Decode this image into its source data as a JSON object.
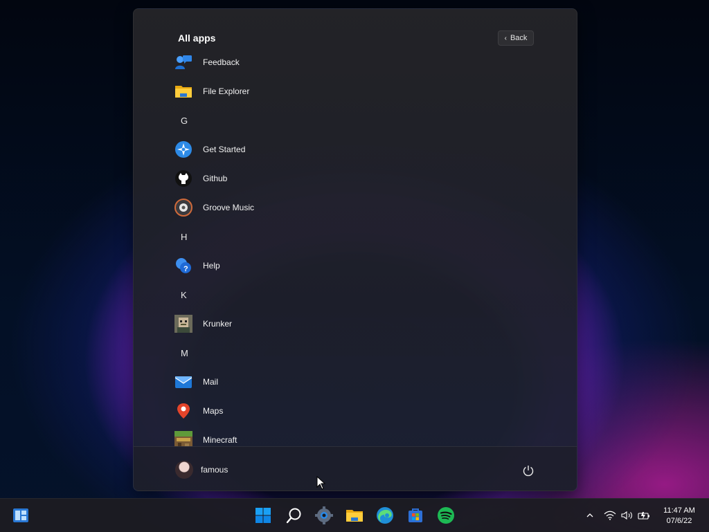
{
  "start_menu": {
    "title": "All apps",
    "back_label": "Back",
    "items": [
      {
        "type": "app",
        "label": "Feedback",
        "icon": "feedback-hub-icon"
      },
      {
        "type": "app",
        "label": "File Explorer",
        "icon": "file-explorer-icon"
      },
      {
        "type": "letter",
        "label": "G"
      },
      {
        "type": "app",
        "label": "Get Started",
        "icon": "get-started-icon"
      },
      {
        "type": "app",
        "label": "Github",
        "icon": "github-icon"
      },
      {
        "type": "app",
        "label": "Groove Music",
        "icon": "groove-music-icon"
      },
      {
        "type": "letter",
        "label": "H"
      },
      {
        "type": "app",
        "label": "Help",
        "icon": "help-icon"
      },
      {
        "type": "letter",
        "label": "K"
      },
      {
        "type": "app",
        "label": "Krunker",
        "icon": "krunker-icon"
      },
      {
        "type": "letter",
        "label": "M"
      },
      {
        "type": "app",
        "label": "Mail",
        "icon": "mail-icon"
      },
      {
        "type": "app",
        "label": "Maps",
        "icon": "maps-icon"
      },
      {
        "type": "app",
        "label": "Minecraft",
        "icon": "minecraft-icon"
      }
    ],
    "user_name": "famous"
  },
  "taskbar": {
    "icons": [
      "widgets-icon",
      "start-icon",
      "search-icon",
      "settings-icon",
      "file-explorer-icon",
      "edge-icon",
      "store-icon",
      "spotify-icon"
    ],
    "tray_icons": [
      "chevron-up-icon",
      "wifi-icon",
      "volume-icon",
      "battery-icon"
    ],
    "time": "11:47 AM",
    "date": "07/6/22"
  },
  "colors": {
    "start_accent": "#0078d4",
    "spotify": "#1db954"
  }
}
